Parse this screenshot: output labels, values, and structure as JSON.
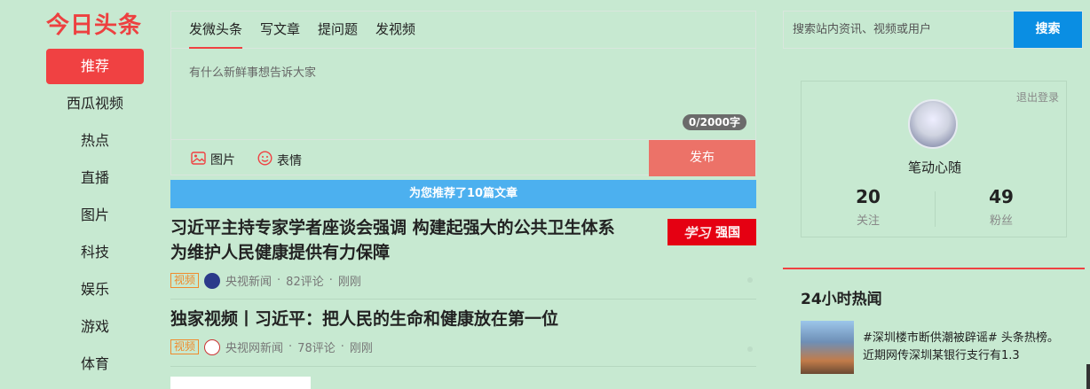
{
  "logo": "今日头条",
  "nav": {
    "items": [
      "推荐",
      "西瓜视频",
      "热点",
      "直播",
      "图片",
      "科技",
      "娱乐",
      "游戏",
      "体育"
    ],
    "active_index": 0
  },
  "publisher": {
    "tabs": [
      "发微头条",
      "写文章",
      "提问题",
      "发视频"
    ],
    "active_tab": 0,
    "placeholder": "有什么新鲜事想告诉大家",
    "counter": "0/2000字",
    "image_label": "图片",
    "emoji_label": "表情",
    "publish_label": "发布"
  },
  "recommend_banner": "为您推荐了10篇文章",
  "feed": [
    {
      "title_line1": "习近平主持专家学者座谈会强调 构建起强大的公共卫生体系",
      "title_line2": "为维护人民健康提供有力保障",
      "tag": "视频",
      "source": "央视新闻",
      "comments": "82评论",
      "time": "刚刚",
      "thumb_text": "强国",
      "thumb_script": "学习"
    },
    {
      "title_line1": "独家视频丨习近平：把人民的生命和健康放在第一位",
      "tag": "视频",
      "source": "央视网新闻",
      "comments": "78评论",
      "time": "刚刚"
    }
  ],
  "search": {
    "placeholder": "搜索站内资讯、视频或用户",
    "button": "搜索"
  },
  "user": {
    "logout": "退出登录",
    "name": "笔动心随",
    "following": "20",
    "following_label": "关注",
    "followers": "49",
    "followers_label": "粉丝"
  },
  "hot": {
    "title": "24小时热闻",
    "item_text": "#深圳楼市断供潮被辟谣# 头条热榜。 近期网传深圳某银行支行有1.3"
  },
  "colors": {
    "background": "#c7e9d1",
    "accent_red": "#f04142",
    "search_blue": "#0a8ee3",
    "banner_blue": "#4cb0ef"
  }
}
